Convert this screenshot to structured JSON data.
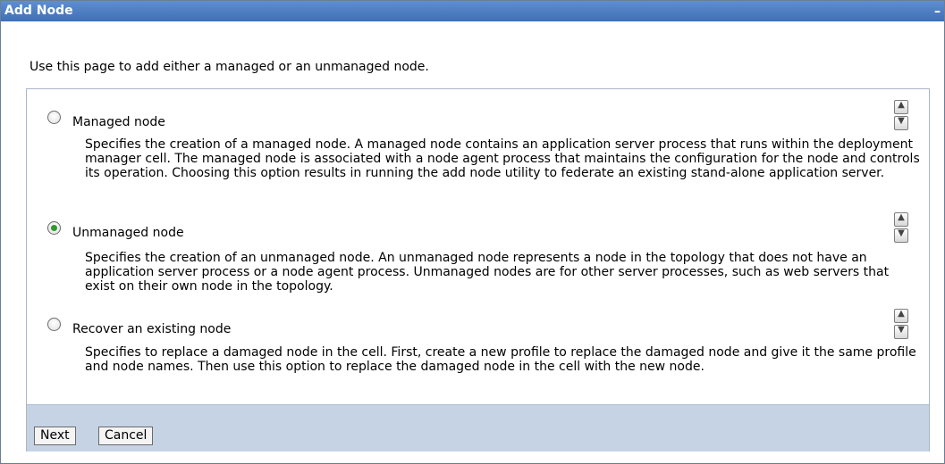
{
  "window": {
    "title": "Add Node",
    "minimize_glyph": "–"
  },
  "intro": "Use this page to add either a managed or an unmanaged node.",
  "options": [
    {
      "label": "Managed node",
      "selected": false,
      "description": "Specifies the creation of a managed node. A managed node contains an application server process that runs within the deployment manager cell. The managed node is associated with a node agent process that maintains the configuration for the node and controls its operation. Choosing this option results in running the add node utility to federate an existing stand-alone application server."
    },
    {
      "label": "Unmanaged node",
      "selected": true,
      "description": "Specifies the creation of an unmanaged node. An unmanaged node represents a node in the topology that does not have an application server process or a node agent process. Unmanaged nodes are for other server processes, such as web servers that exist on their own node in the topology."
    },
    {
      "label": "Recover an existing node",
      "selected": false,
      "description": "Specifies to replace a damaged node in the cell. First, create a new profile to replace the damaged node and give it the same profile and node names. Then use this option to replace the damaged node in the cell with the new node."
    }
  ],
  "buttons": {
    "next": "Next",
    "cancel": "Cancel"
  },
  "colors": {
    "titlebar": "#4a7cc1",
    "footer": "#c5d3e4",
    "radio_selected": "#2f9a2f"
  }
}
